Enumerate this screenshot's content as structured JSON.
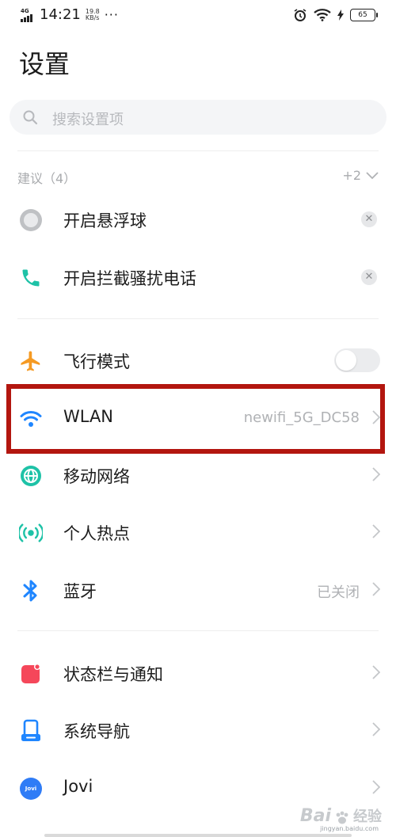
{
  "status_bar": {
    "network": "4G",
    "time": "14:21",
    "speed_value": "19.8",
    "speed_unit": "KB/s",
    "more": "···",
    "battery": "65"
  },
  "page": {
    "title": "设置",
    "search_placeholder": "搜索设置项"
  },
  "suggestions": {
    "header": "建议（4）",
    "more": "+2",
    "items": [
      {
        "label": "开启悬浮球",
        "icon": "floating-ball-icon"
      },
      {
        "label": "开启拦截骚扰电话",
        "icon": "phone-icon"
      }
    ]
  },
  "connectivity": [
    {
      "label": "飞行模式",
      "icon": "airplane-icon",
      "control": "toggle",
      "toggle_on": false
    },
    {
      "label": "WLAN",
      "icon": "wifi-icon",
      "value": "newifi_5G_DC58",
      "highlighted": true
    },
    {
      "label": "移动网络",
      "icon": "globe-icon"
    },
    {
      "label": "个人热点",
      "icon": "hotspot-icon"
    },
    {
      "label": "蓝牙",
      "icon": "bluetooth-icon",
      "value": "已关闭"
    }
  ],
  "system": [
    {
      "label": "状态栏与通知",
      "icon": "notification-icon"
    },
    {
      "label": "系统导航",
      "icon": "navigation-icon"
    },
    {
      "label": "Jovi",
      "icon": "jovi-icon",
      "icon_text": "Jovi"
    }
  ],
  "watermark": {
    "brand": "Bai",
    "suffix": "经验",
    "url": "jingyan.baidu.com"
  },
  "colors": {
    "accent": "#1f86ff",
    "green": "#1ec2a7",
    "airplane": "#f59a23",
    "notify": "#f5475a",
    "highlight_border": "#b3160f"
  }
}
